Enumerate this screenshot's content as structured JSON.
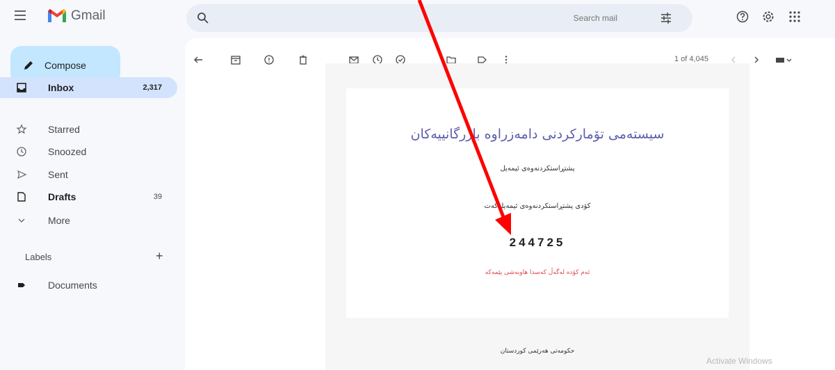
{
  "header": {
    "app_name": "Gmail",
    "search_placeholder": "Search mail",
    "accent": "#ea4335"
  },
  "compose": {
    "label": "Compose"
  },
  "nav": {
    "items": [
      {
        "label": "Inbox",
        "count": "2,317",
        "icon": "inbox-icon",
        "active": true,
        "bold": true
      },
      {
        "label": "Starred",
        "count": "",
        "icon": "star-icon"
      },
      {
        "label": "Snoozed",
        "count": "",
        "icon": "clock-icon"
      },
      {
        "label": "Sent",
        "count": "",
        "icon": "send-icon"
      },
      {
        "label": "Drafts",
        "count": "39",
        "icon": "draft-icon",
        "bold": true
      },
      {
        "label": "More",
        "count": "",
        "icon": "chevron-down-icon"
      }
    ],
    "labels_title": "Labels",
    "labels_add": "+",
    "labels": [
      {
        "label": "Documents",
        "icon": "label-icon"
      }
    ]
  },
  "toolbar": {
    "pager": "1 of 4,045"
  },
  "email": {
    "title": "سیستەمی تۆمارکردنی دامەزراوە بازرگانییەکان",
    "line1": "پشتڕاستکردنەوەی ئیمەیل",
    "line2": "کۆدی پشتڕاستکردنەوەی ئیمەیلەکەت",
    "code": "244725",
    "warning": "ئەم کۆدە لەگەڵ کەسدا هاوبەشی پێمەکە",
    "footer": "حکومەتی هەرێمی کوردستان"
  },
  "watermark": "Activate Windows",
  "annotation": {
    "arrow_color": "#ff0000"
  }
}
